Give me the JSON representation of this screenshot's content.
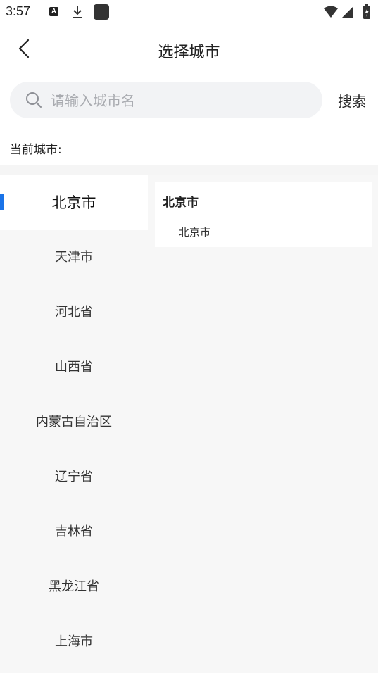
{
  "status_bar": {
    "time": "3:57",
    "a_badge": "A",
    "icons": [
      "a-notification-icon",
      "download-icon",
      "app-square-icon",
      "wifi-icon",
      "signal-icon",
      "battery-icon"
    ]
  },
  "header": {
    "back_icon": "chevron-left-icon",
    "title": "选择城市"
  },
  "search": {
    "placeholder": "请输入城市名",
    "value": "",
    "button_label": "搜索",
    "icon": "search-icon"
  },
  "current_city": {
    "label": "当前城市:"
  },
  "provinces": [
    {
      "label": "北京市",
      "active": true
    },
    {
      "label": "天津市",
      "active": false
    },
    {
      "label": "河北省",
      "active": false
    },
    {
      "label": "山西省",
      "active": false
    },
    {
      "label": "内蒙古自治区",
      "active": false
    },
    {
      "label": "辽宁省",
      "active": false
    },
    {
      "label": "吉林省",
      "active": false
    },
    {
      "label": "黑龙江省",
      "active": false
    },
    {
      "label": "上海市",
      "active": false
    }
  ],
  "city_panel": {
    "group_title": "北京市",
    "cities": [
      "北京市"
    ]
  },
  "colors": {
    "accent": "#1a73e8",
    "search_bg": "#f2f3f5",
    "list_bg": "#f7f7f7",
    "placeholder": "#a9abb0"
  }
}
